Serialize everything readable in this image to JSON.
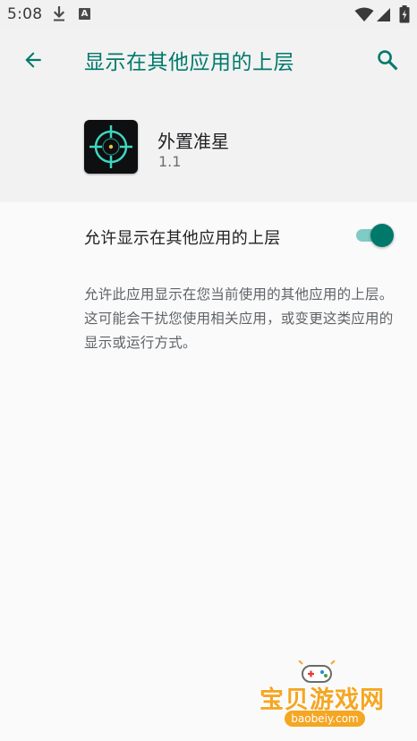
{
  "status_bar": {
    "time": "5:08",
    "icons": [
      "download-icon",
      "a-badge-icon",
      "wifi-icon",
      "signal-icon",
      "battery-icon"
    ],
    "a_badge": "A"
  },
  "toolbar": {
    "title": "显示在其他应用的上层",
    "back_icon": "arrow-left-icon",
    "search_icon": "search-icon"
  },
  "app": {
    "name": "外置准星",
    "version": "1.1",
    "icon": "crosshair-icon"
  },
  "setting": {
    "label": "允许显示在其他应用的上层",
    "enabled": true
  },
  "description": "允许此应用显示在您当前使用的其他应用的上层。这可能会干扰您使用相关应用，或变更这类应用的显示或运行方式。",
  "watermark": {
    "title": "宝贝游戏网",
    "url": "baobeiy.com"
  },
  "colors": {
    "accent": "#00796b",
    "toggle_track": "#80cbc4",
    "header_background": "#f2f2f2",
    "page_background": "#fafafa",
    "watermark_orange": "#f5a623"
  }
}
